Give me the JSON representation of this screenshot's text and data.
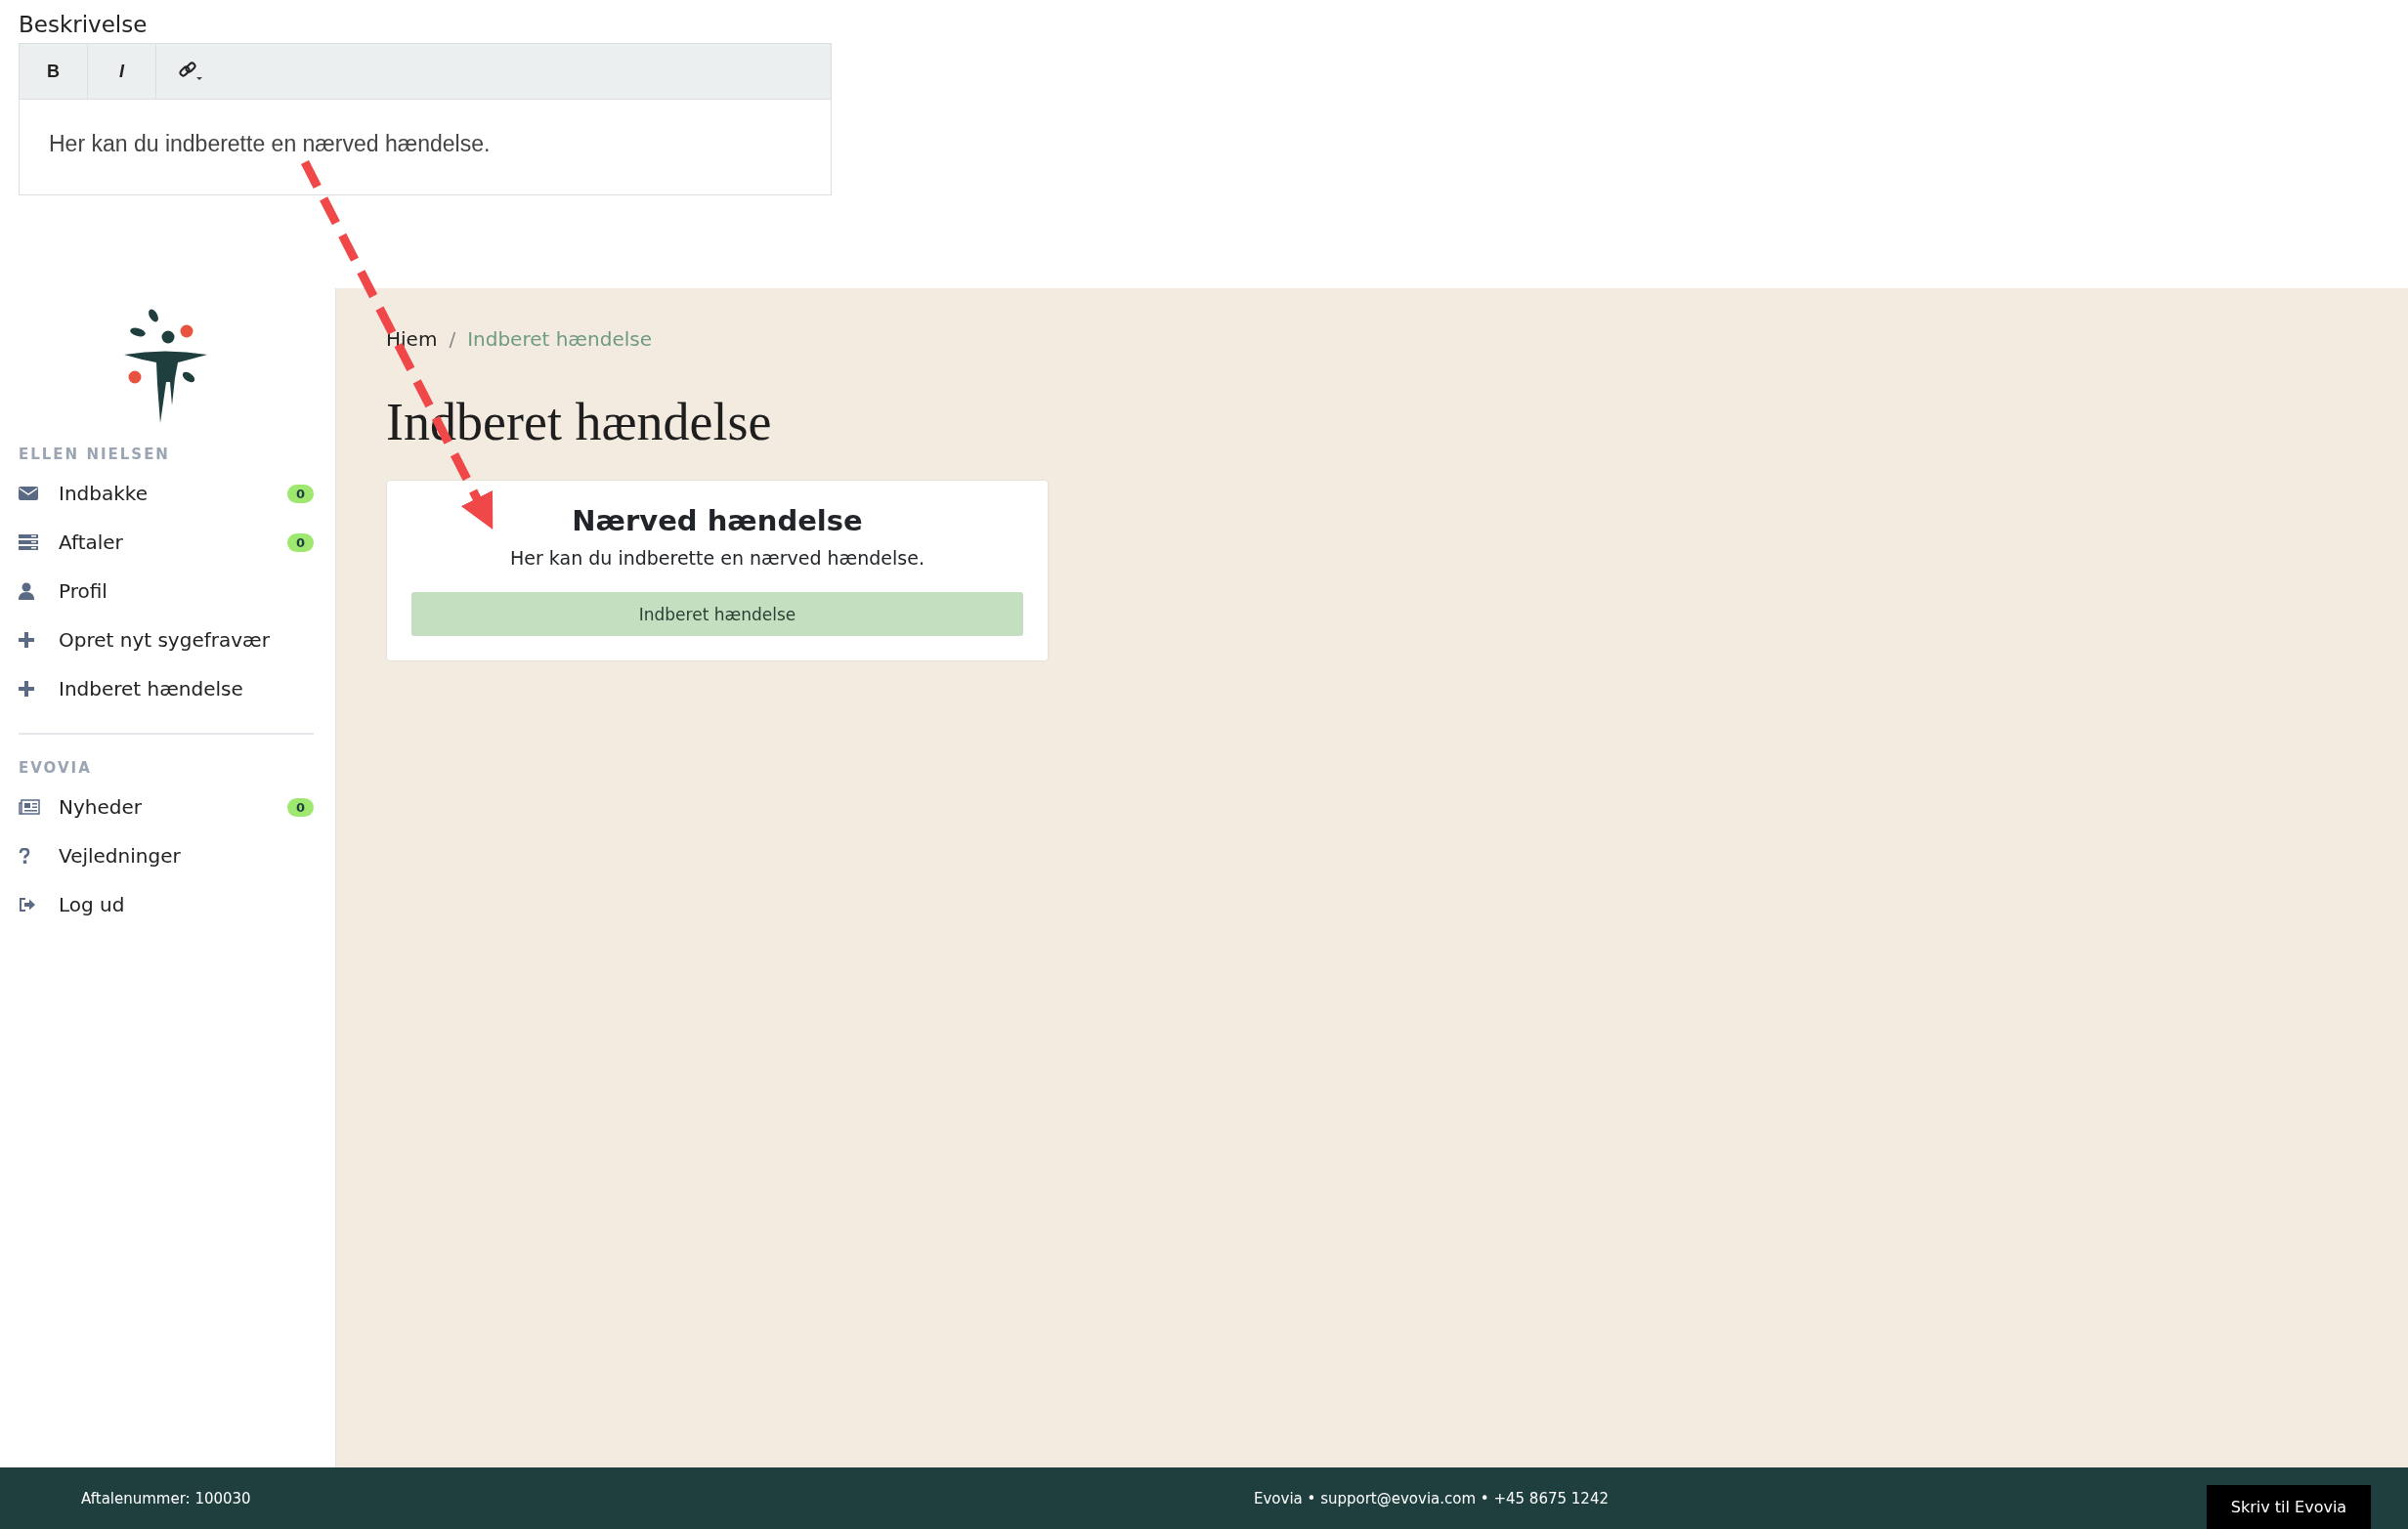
{
  "editor": {
    "label": "Beskrivelse",
    "toolbar": [
      {
        "kind": "bold",
        "label": "B"
      },
      {
        "kind": "italic",
        "label": "I"
      },
      {
        "kind": "link"
      }
    ],
    "content": "Her kan du indberette en nærved hændelse."
  },
  "sidebar": {
    "sections": [
      {
        "heading": "ELLEN NIELSEN",
        "items": [
          {
            "kind": "envelope",
            "label": "Indbakke",
            "badge": "0"
          },
          {
            "kind": "list",
            "label": "Aftaler",
            "badge": "0"
          },
          {
            "kind": "user",
            "label": "Profil"
          },
          {
            "kind": "plus",
            "label": "Opret nyt sygefravær"
          },
          {
            "kind": "plus",
            "label": "Indberet hændelse"
          }
        ]
      },
      {
        "heading": "EVOVIA",
        "items": [
          {
            "kind": "newspaper",
            "label": "Nyheder",
            "badge": "0"
          },
          {
            "kind": "question",
            "label": "Vejledninger"
          },
          {
            "kind": "signout",
            "label": "Log ud"
          }
        ]
      }
    ]
  },
  "breadcrumb": [
    {
      "label": "Hjem",
      "current": false
    },
    {
      "separator": "/",
      "label": "Indberet hændelse",
      "current": true
    }
  ],
  "page_title": "Indberet hændelse",
  "card": {
    "title": "Nærved hændelse",
    "text": "Her kan du indberette en nærved hændelse.",
    "button": "Indberet hændelse"
  },
  "footer": {
    "agreement": "Aftalenummer: 100030",
    "contact": "Evovia • support@evovia.com • +45 8675 1242",
    "button": "Skriv til Evovia"
  }
}
